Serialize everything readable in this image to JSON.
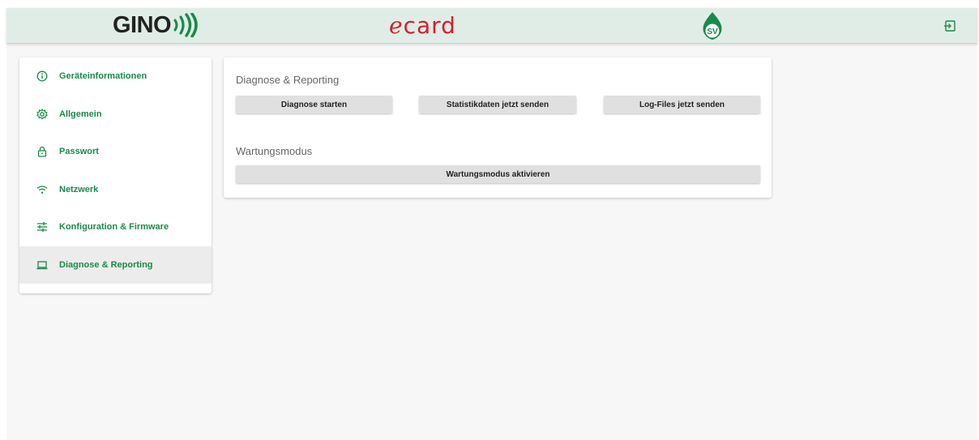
{
  "header": {
    "logo_gino": "GINO",
    "logo_ecard_e": "e",
    "logo_ecard_rest": "card",
    "logo_sv": "SV",
    "logout_icon": "logout-icon",
    "colors": {
      "bar_bg": "#e0ede6",
      "gino_accent": "#1a8a4a",
      "ecard_red": "#d0202e",
      "sv_green": "#1a8a4a"
    }
  },
  "sidebar": {
    "items": [
      {
        "icon": "info-icon",
        "label": "Geräteinformationen",
        "active": false
      },
      {
        "icon": "gear-icon",
        "label": "Allgemein",
        "active": false
      },
      {
        "icon": "lock-icon",
        "label": "Passwort",
        "active": false
      },
      {
        "icon": "wifi-icon",
        "label": "Netzwerk",
        "active": false
      },
      {
        "icon": "tune-icon",
        "label": "Konfiguration & Firmware",
        "active": false
      },
      {
        "icon": "laptop-icon",
        "label": "Diagnose & Reporting",
        "active": true
      }
    ],
    "accent_color": "#1a8a4a"
  },
  "main": {
    "diagnose": {
      "title": "Diagnose & Reporting",
      "buttons": [
        "Diagnose starten",
        "Statistikdaten jetzt senden",
        "Log-Files jetzt senden"
      ]
    },
    "wartung": {
      "title": "Wartungsmodus",
      "button": "Wartungsmodus aktivieren"
    }
  }
}
